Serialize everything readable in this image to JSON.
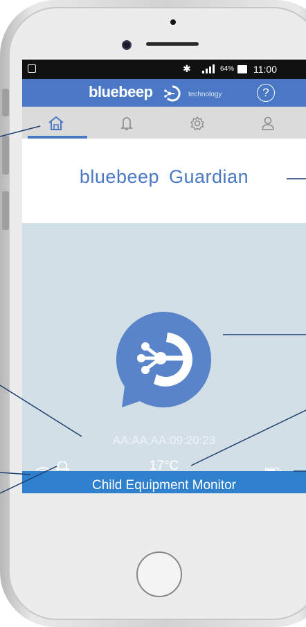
{
  "status_bar": {
    "bluetooth_icon": "bluetooth-icon",
    "signal_icon": "signal-icon",
    "battery_percent": "64%",
    "time": "11:00"
  },
  "app_bar": {
    "brand": "bluebeep",
    "tagline": "technology",
    "help_label": "?"
  },
  "tabs": [
    {
      "icon": "home-icon",
      "active": true
    },
    {
      "icon": "bell-icon",
      "active": false
    },
    {
      "icon": "gear-icon",
      "active": false
    },
    {
      "icon": "user-icon",
      "active": false
    }
  ],
  "title": "bluebeep Guardian",
  "device": {
    "mac_address": "AA:AA:AA:09:20:23",
    "temperature": "17°C",
    "battery_level": 0.8
  },
  "footer": {
    "label": "Child Equipment Monitor"
  },
  "colors": {
    "brand_blue": "#4a78c5",
    "footer_blue": "#2f80cd",
    "screen_bg": "#d3dfe6",
    "callout_line": "#1e3f6e"
  }
}
